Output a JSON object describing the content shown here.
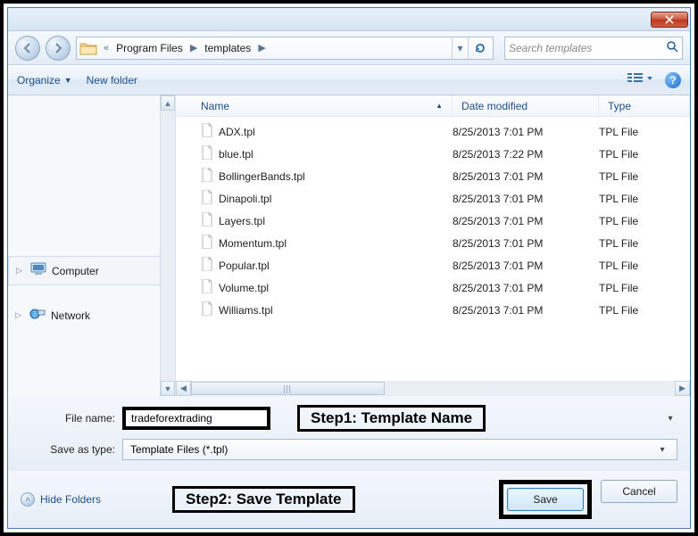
{
  "breadcrumb": {
    "sep1": "«",
    "segment1": "Program Files",
    "sep2": "▶",
    "segment2": "templates",
    "sep3": "▶"
  },
  "search": {
    "placeholder": "Search templates"
  },
  "toolbar": {
    "organize": "Organize",
    "new_folder": "New folder"
  },
  "sidebar": {
    "computer": "Computer",
    "network": "Network"
  },
  "columns": {
    "name": "Name",
    "date": "Date modified",
    "type": "Type"
  },
  "files": [
    {
      "name": "ADX.tpl",
      "date": "8/25/2013 7:01 PM",
      "type": "TPL File"
    },
    {
      "name": "blue.tpl",
      "date": "8/25/2013 7:22 PM",
      "type": "TPL File"
    },
    {
      "name": "BollingerBands.tpl",
      "date": "8/25/2013 7:01 PM",
      "type": "TPL File"
    },
    {
      "name": "Dinapoli.tpl",
      "date": "8/25/2013 7:01 PM",
      "type": "TPL File"
    },
    {
      "name": "Layers.tpl",
      "date": "8/25/2013 7:01 PM",
      "type": "TPL File"
    },
    {
      "name": "Momentum.tpl",
      "date": "8/25/2013 7:01 PM",
      "type": "TPL File"
    },
    {
      "name": "Popular.tpl",
      "date": "8/25/2013 7:01 PM",
      "type": "TPL File"
    },
    {
      "name": "Volume.tpl",
      "date": "8/25/2013 7:01 PM",
      "type": "TPL File"
    },
    {
      "name": "Williams.tpl",
      "date": "8/25/2013 7:01 PM",
      "type": "TPL File"
    }
  ],
  "form": {
    "file_name_label": "File name:",
    "file_name_value": "tradeforextrading",
    "save_as_type_label": "Save as type:",
    "save_as_type_value": "Template Files (*.tpl)"
  },
  "annotations": {
    "step1": "Step1: Template Name",
    "step2": "Step2: Save Template"
  },
  "footer": {
    "hide_folders": "Hide Folders",
    "save": "Save",
    "cancel": "Cancel"
  }
}
